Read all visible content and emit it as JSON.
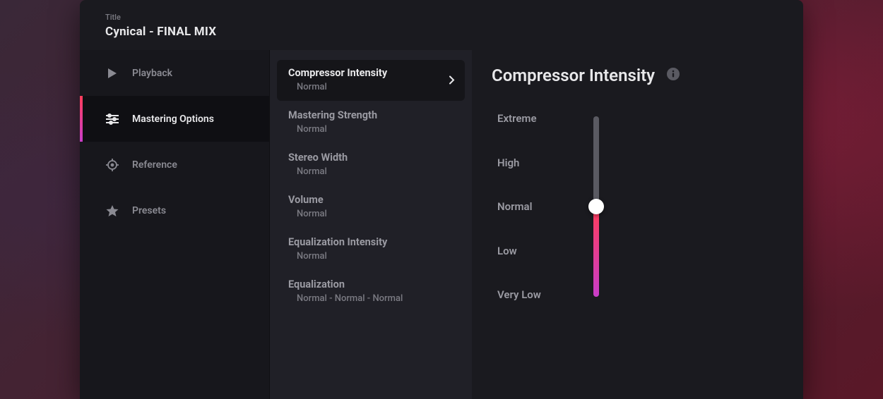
{
  "header": {
    "title_label": "Title",
    "title_value": "Cynical - FINAL MIX"
  },
  "sidebar": {
    "items": [
      {
        "label": "Playback",
        "icon": "play-icon"
      },
      {
        "label": "Mastering Options",
        "icon": "sliders-icon"
      },
      {
        "label": "Reference",
        "icon": "target-icon"
      },
      {
        "label": "Presets",
        "icon": "star-icon"
      }
    ],
    "active_index": 1
  },
  "options": {
    "items": [
      {
        "title": "Compressor Intensity",
        "value": "Normal"
      },
      {
        "title": "Mastering Strength",
        "value": "Normal"
      },
      {
        "title": "Stereo Width",
        "value": "Normal"
      },
      {
        "title": "Volume",
        "value": "Normal"
      },
      {
        "title": "Equalization Intensity",
        "value": "Normal"
      },
      {
        "title": "Equalization",
        "value": "Normal -  Normal -  Normal"
      }
    ],
    "selected_index": 0
  },
  "detail": {
    "title": "Compressor Intensity",
    "levels": [
      "Extreme",
      "High",
      "Normal",
      "Low",
      "Very Low"
    ],
    "current_level": "Normal"
  }
}
